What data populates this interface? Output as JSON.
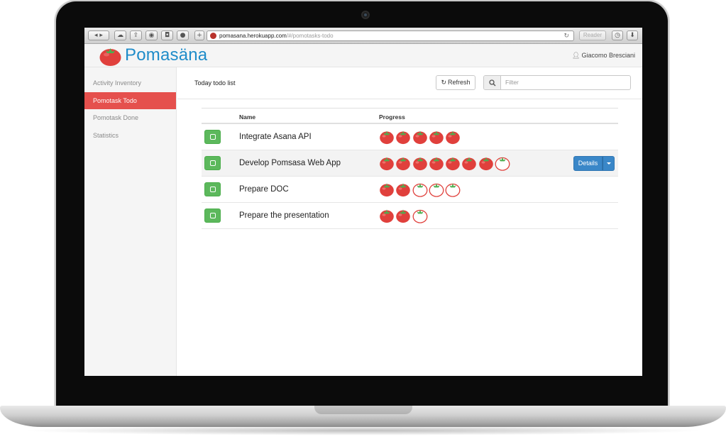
{
  "browser": {
    "url_host": "pomasana.herokuapp.com",
    "url_path": "/#/pomotasks-todo",
    "reader_label": "Reader"
  },
  "header": {
    "brand": "Pomasäna",
    "user_name": "Giacomo Bresciani"
  },
  "sidebar": {
    "items": [
      {
        "label": "Activity Inventory"
      },
      {
        "label": "Pomotask Todo",
        "active": true
      },
      {
        "label": "Pomotask Done"
      },
      {
        "label": "Statistics"
      }
    ]
  },
  "main": {
    "title": "Today todo list",
    "refresh_label": "Refresh",
    "filter_placeholder": "Filter",
    "columns": {
      "name": "Name",
      "progress": "Progress"
    },
    "tasks": [
      {
        "name": "Integrate Asana API",
        "done_pomodoros": 5,
        "pending_pomodoros": 0
      },
      {
        "name": "Develop Pomsasa Web App",
        "done_pomodoros": 7,
        "pending_pomodoros": 1,
        "details_label": "Details"
      },
      {
        "name": "Prepare DOC",
        "done_pomodoros": 2,
        "pending_pomodoros": 3
      },
      {
        "name": "Prepare the presentation",
        "done_pomodoros": 2,
        "pending_pomodoros": 1
      }
    ]
  },
  "colors": {
    "accent_red": "#e5504d",
    "brand_blue": "#1f8cc9",
    "success_green": "#5cb85c",
    "primary_blue": "#3a87c8"
  },
  "icons": {
    "done_pomodoro": "tomato-filled-icon",
    "pending_pomodoro": "tomato-outline-icon"
  }
}
